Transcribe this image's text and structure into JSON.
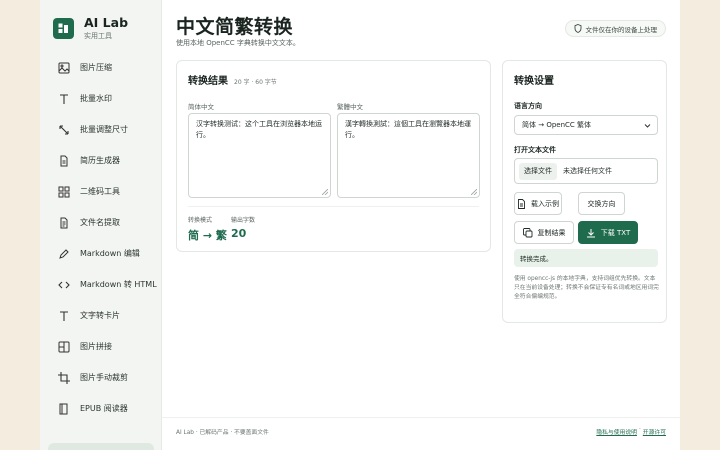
{
  "brand": {
    "name": "AI Lab",
    "subtitle": "实用工具"
  },
  "sidebar": {
    "items": [
      {
        "label": "图片压缩",
        "icon": "image-icon"
      },
      {
        "label": "批量水印",
        "icon": "text-t-icon"
      },
      {
        "label": "批量调整尺寸",
        "icon": "resize-icon"
      },
      {
        "label": "简历生成器",
        "icon": "document-icon"
      },
      {
        "label": "二维码工具",
        "icon": "grid-icon"
      },
      {
        "label": "文件名提取",
        "icon": "file-icon"
      },
      {
        "label": "Markdown 编辑",
        "icon": "pen-icon"
      },
      {
        "label": "Markdown 转 HTML",
        "icon": "code-icon"
      },
      {
        "label": "文字转卡片",
        "icon": "text-t-icon"
      },
      {
        "label": "图片拼接",
        "icon": "collage-icon"
      },
      {
        "label": "图片手动裁剪",
        "icon": "crop-icon"
      },
      {
        "label": "EPUB 阅读器",
        "icon": "book-icon"
      }
    ]
  },
  "header": {
    "title": "中文简繁转换",
    "subtitle": "使用本地 OpenCC 字典转换中文文本。",
    "privacy": "文件仅在你的设备上处理"
  },
  "convert": {
    "title": "转换结果",
    "meta": "20 字 · 60 字节",
    "source_label": "简体中文",
    "source_text": "汉字转换测试：这个工具在浏览器本地运行。",
    "target_label": "繁體中文",
    "target_text": "漢字轉換測試：這個工具在瀏覽器本地運行。",
    "mode_label": "转换模式",
    "mode_value": "简 → 繁",
    "count_label": "输出字数",
    "count_value": "20"
  },
  "settings": {
    "title": "转换设置",
    "direction_label": "语言方向",
    "direction_value": "简体 → OpenCC 繁体",
    "file_label": "打开文本文件",
    "file_button": "选择文件",
    "file_status": "未选择任何文件",
    "load_example": "载入示例",
    "swap": "交换方向",
    "copy": "复制结果",
    "download": "下载 TXT",
    "status": "转换完成。",
    "note": "使用 opencc-js 的本地字典，支持词组优先转换。文本只在当前设备处理；转换不会保证专有名词或地区用词完全符合偏编规范。"
  },
  "footer": {
    "left": "AI Lab · 已解码产品 · 不要盖面文件",
    "link1": "隐私与使用说明",
    "sep": "·",
    "link2": "开源许可"
  },
  "colors": {
    "accent": "#1f6b4e",
    "background": "#f4ecdf"
  }
}
